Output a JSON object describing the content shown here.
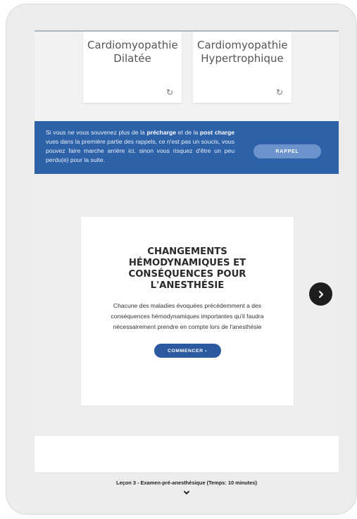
{
  "cards": [
    {
      "title": "Cardiomyopathie Dilatée",
      "flip_icon": "refresh-icon"
    },
    {
      "title": "Cardiomyopathie Hypertrophique",
      "flip_icon": "refresh-icon"
    }
  ],
  "banner": {
    "t1": "Si vous ne vous souvenez plus de la ",
    "b1": "précharge",
    "t2": " et de la ",
    "b2": "post charge",
    "t3": " vues dans la première partie des rappels, ce n'est pas un soucis, vous pouvez faire marche arrière ici, sinon vous risquez d'être un peu perdu(e) pour la suite.",
    "button": "RAPPEL",
    "bg_color": "#2d62a9"
  },
  "section": {
    "title": "CHANGEMENTS HÉMODYNAMIQUES ET CONSÉQUENCES POUR L'ANESTHÉSIE",
    "description": "Chacune des maladies évoquées précédemment a des conséquences hémodynamiques importantes qu'il faudra nécessairement prendre en compte lors de l'anesthésie",
    "button": "COMMENCER ›",
    "next_icon": "chevron-right-icon"
  },
  "footer": {
    "lesson": "Leçon 3 - Examen-pré-anesthésique (Temps: 10 minutes)",
    "icon": "chevron-down-icon"
  }
}
